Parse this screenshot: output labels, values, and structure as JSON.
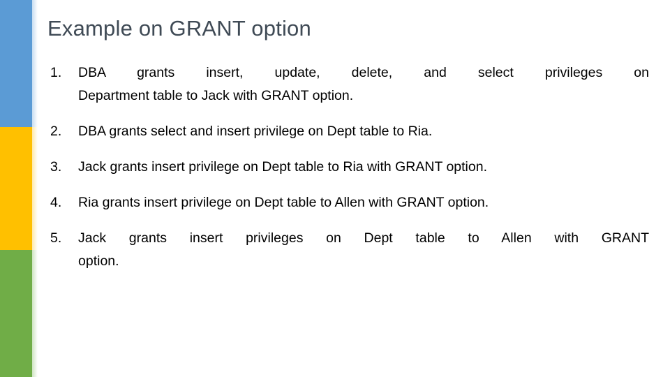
{
  "slide": {
    "title": "Example on GRANT option",
    "title_color": "#3f4a55",
    "background_color": "#ffffff",
    "body_text_color": "#000000"
  },
  "sidebar": {
    "bars": [
      {
        "name": "blue-bar",
        "color": "#5b9bd5"
      },
      {
        "name": "yellow-bar",
        "color": "#ffc000"
      },
      {
        "name": "green-bar",
        "color": "#70ad47"
      }
    ]
  },
  "body": {
    "items": [
      {
        "marker": "1.",
        "line_1": "DBA grants insert, update, delete, and select privileges on",
        "line_2": "Department table to Jack with GRANT option.",
        "full_text": "DBA grants insert, update, delete, and select privileges on Department table to Jack with GRANT option."
      },
      {
        "marker": "2.",
        "line_1": "DBA grants select and insert privilege on Dept table to Ria.",
        "line_2": "",
        "full_text": "DBA grants select and insert privilege on Dept table to Ria."
      },
      {
        "marker": "3.",
        "line_1": "Jack grants insert privilege on Dept table to Ria with GRANT option.",
        "line_2": "",
        "full_text": "Jack grants insert privilege on Dept table to Ria with GRANT option."
      },
      {
        "marker": "4.",
        "line_1": "Ria grants insert privilege on Dept table to Allen with GRANT option.",
        "line_2": "",
        "full_text": "Ria grants insert privilege on Dept table to Allen with GRANT option."
      },
      {
        "marker": "5.",
        "line_1": "Jack grants insert privileges on Dept table to Allen with GRANT",
        "line_2": "option.",
        "full_text": "Jack grants insert privileges on Dept table to Allen with GRANT option."
      }
    ]
  }
}
